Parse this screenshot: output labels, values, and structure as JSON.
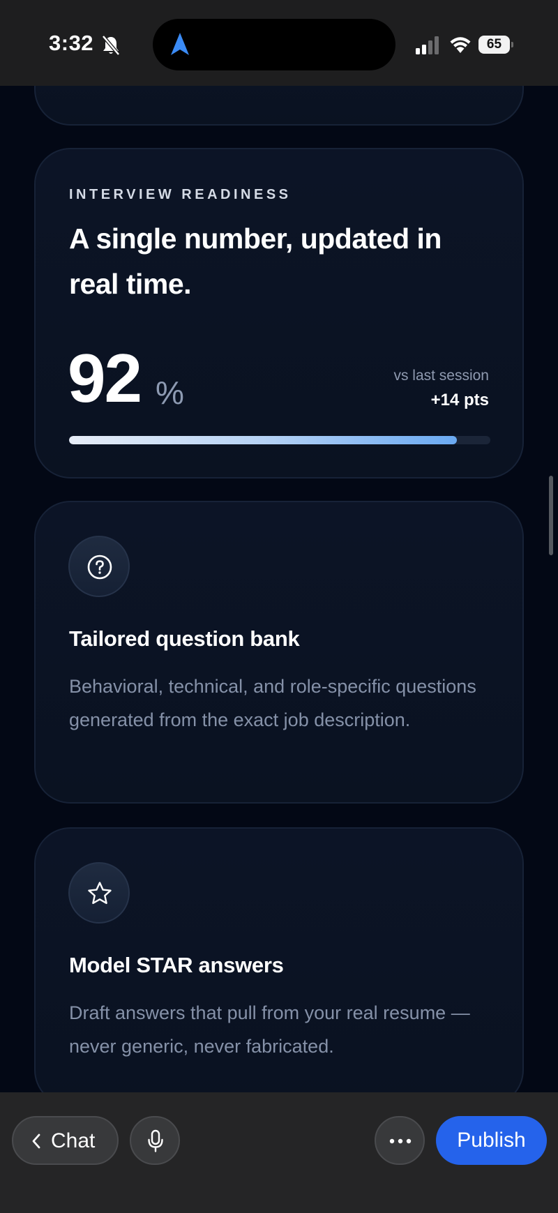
{
  "status_bar": {
    "time": "3:32",
    "battery": "65",
    "icons": [
      "bell-slash-icon",
      "location-arrow-icon",
      "cellular-signal-icon",
      "wifi-icon",
      "battery-icon"
    ]
  },
  "readiness": {
    "eyebrow": "INTERVIEW READINESS",
    "title": "A single number, updated in real time.",
    "score": "92",
    "unit": "%",
    "vs_label": "vs last session",
    "delta": "+14 pts",
    "progress_fraction": 0.92
  },
  "features": [
    {
      "icon": "question-circle-icon",
      "title": "Tailored question bank",
      "description": "Behavioral, technical, and role-specific questions generated from the exact job description."
    },
    {
      "icon": "star-icon",
      "title": "Model STAR answers",
      "description": "Draft answers that pull from your real resume — never generic, never fabricated."
    }
  ],
  "bottom_bar": {
    "chat_label": "Chat",
    "publish_label": "Publish"
  },
  "colors": {
    "accent": "#2563eb",
    "card_bg": "#0b1324",
    "progress_end": "#6aa9f2"
  }
}
